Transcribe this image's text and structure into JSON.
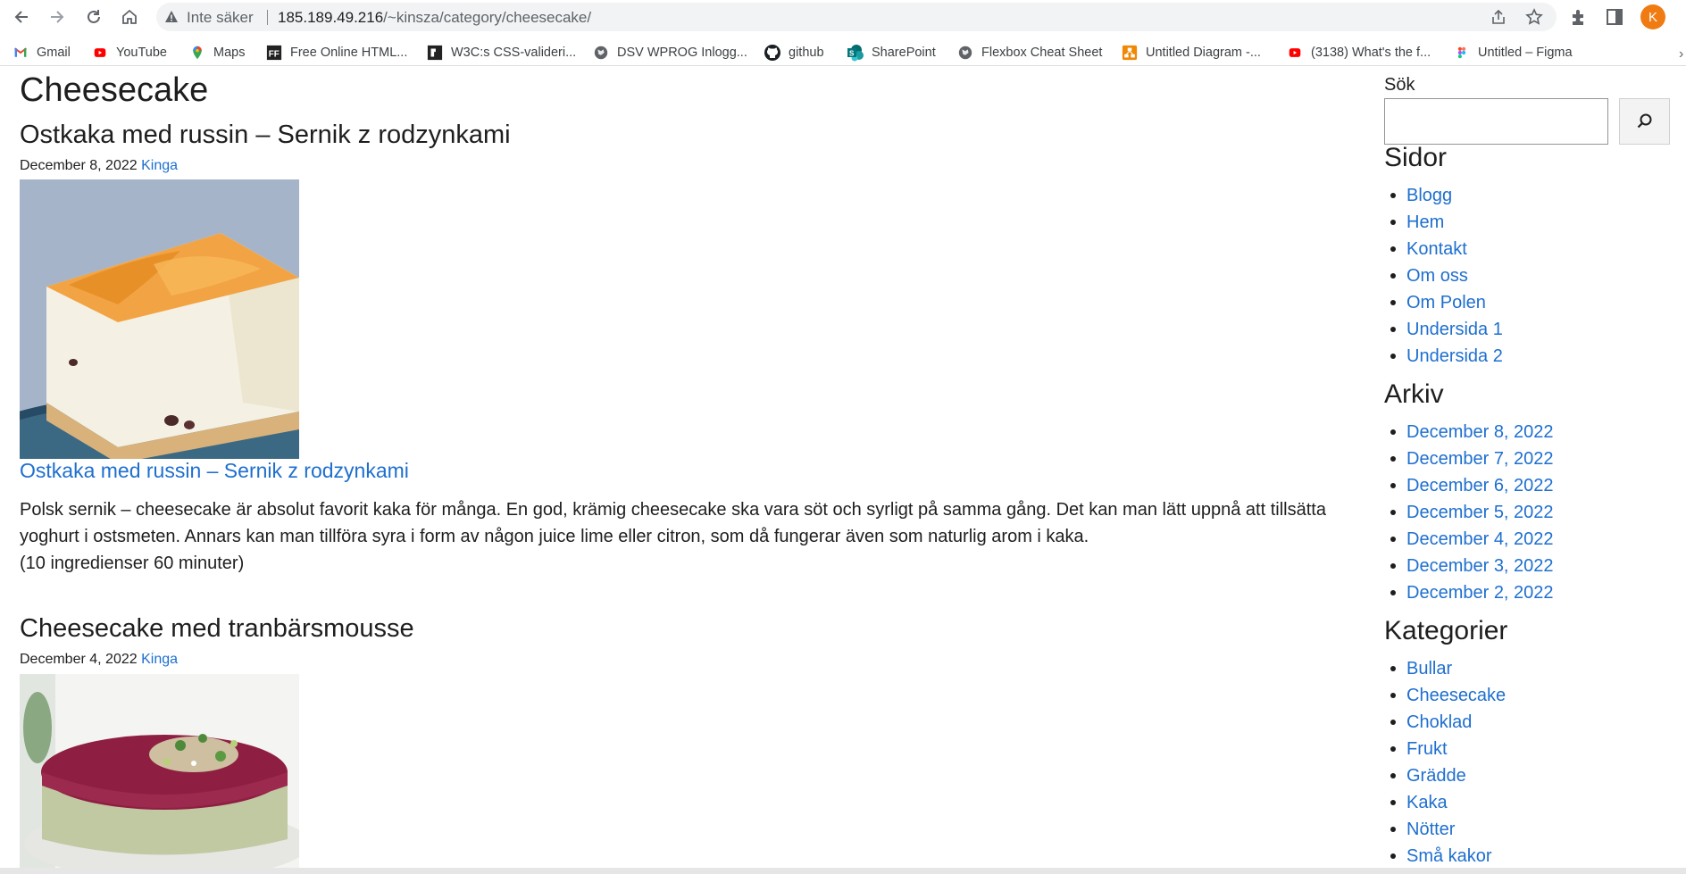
{
  "browser": {
    "insecure_label": "Inte säker",
    "url_host": "185.189.49.216",
    "url_path": "/~kinsza/category/cheesecake/",
    "avatar_initial": "K",
    "icons": [
      "back-icon",
      "forward-icon",
      "reload-icon",
      "home-icon",
      "warning-icon",
      "share-icon",
      "star-icon",
      "extensions-icon",
      "sidepanel-icon"
    ]
  },
  "bookmarks": [
    {
      "label": "Gmail",
      "icon": "gmail-icon"
    },
    {
      "label": "YouTube",
      "icon": "youtube-icon"
    },
    {
      "label": "Maps",
      "icon": "maps-icon"
    },
    {
      "label": "Free Online HTML...",
      "icon": "ff-icon"
    },
    {
      "label": "W3C:s CSS-valideri...",
      "icon": "w3c-icon"
    },
    {
      "label": "DSV WPROG Inlogg...",
      "icon": "globe-icon"
    },
    {
      "label": "github",
      "icon": "github-icon"
    },
    {
      "label": "SharePoint",
      "icon": "sharepoint-icon"
    },
    {
      "label": "Flexbox Cheat Sheet",
      "icon": "globe-icon"
    },
    {
      "label": "Untitled Diagram -...",
      "icon": "drawio-icon"
    },
    {
      "label": "(3138) What's the f...",
      "icon": "youtube-icon"
    },
    {
      "label": "Untitled – Figma",
      "icon": "figma-icon"
    }
  ],
  "page": {
    "title": "Cheesecake"
  },
  "posts": [
    {
      "title": "Ostkaka med russin – Sernik z rodzynkami",
      "date": "December 8, 2022",
      "author": "Kinga",
      "link_text": "Ostkaka med russin – Sernik z rodzynkami",
      "excerpt_line1": "Polsk sernik – cheesecake är absolut favorit kaka för många. En god, krämig cheesecake ska vara söt och syrligt på samma gång. Det kan man lätt uppnå att tillsätta",
      "excerpt_line2": "yoghurt i ostsmeten. Annars kan man tillföra syra i form av någon juice lime eller citron, som då fungerar även som naturlig arom i kaka.",
      "excerpt_line3": "(10 ingredienser 60 minuter)"
    },
    {
      "title": "Cheesecake med tranbärsmousse",
      "date": "December 4, 2022",
      "author": "Kinga"
    }
  ],
  "sidebar": {
    "search_label": "Sök",
    "search_value": "",
    "pages_title": "Sidor",
    "pages": [
      "Blogg",
      "Hem",
      "Kontakt",
      "Om oss",
      "Om Polen",
      "Undersida 1",
      "Undersida 2"
    ],
    "archive_title": "Arkiv",
    "archive": [
      "December 8, 2022",
      "December 7, 2022",
      "December 6, 2022",
      "December 5, 2022",
      "December 4, 2022",
      "December 3, 2022",
      "December 2, 2022"
    ],
    "categories_title": "Kategorier",
    "categories": [
      "Bullar",
      "Cheesecake",
      "Choklad",
      "Frukt",
      "Grädde",
      "Kaka",
      "Nötter",
      "Små kakor"
    ]
  },
  "colors": {
    "link": "#1e6fcf",
    "text": "#1e1e1e",
    "avatar": "#f07b12"
  }
}
